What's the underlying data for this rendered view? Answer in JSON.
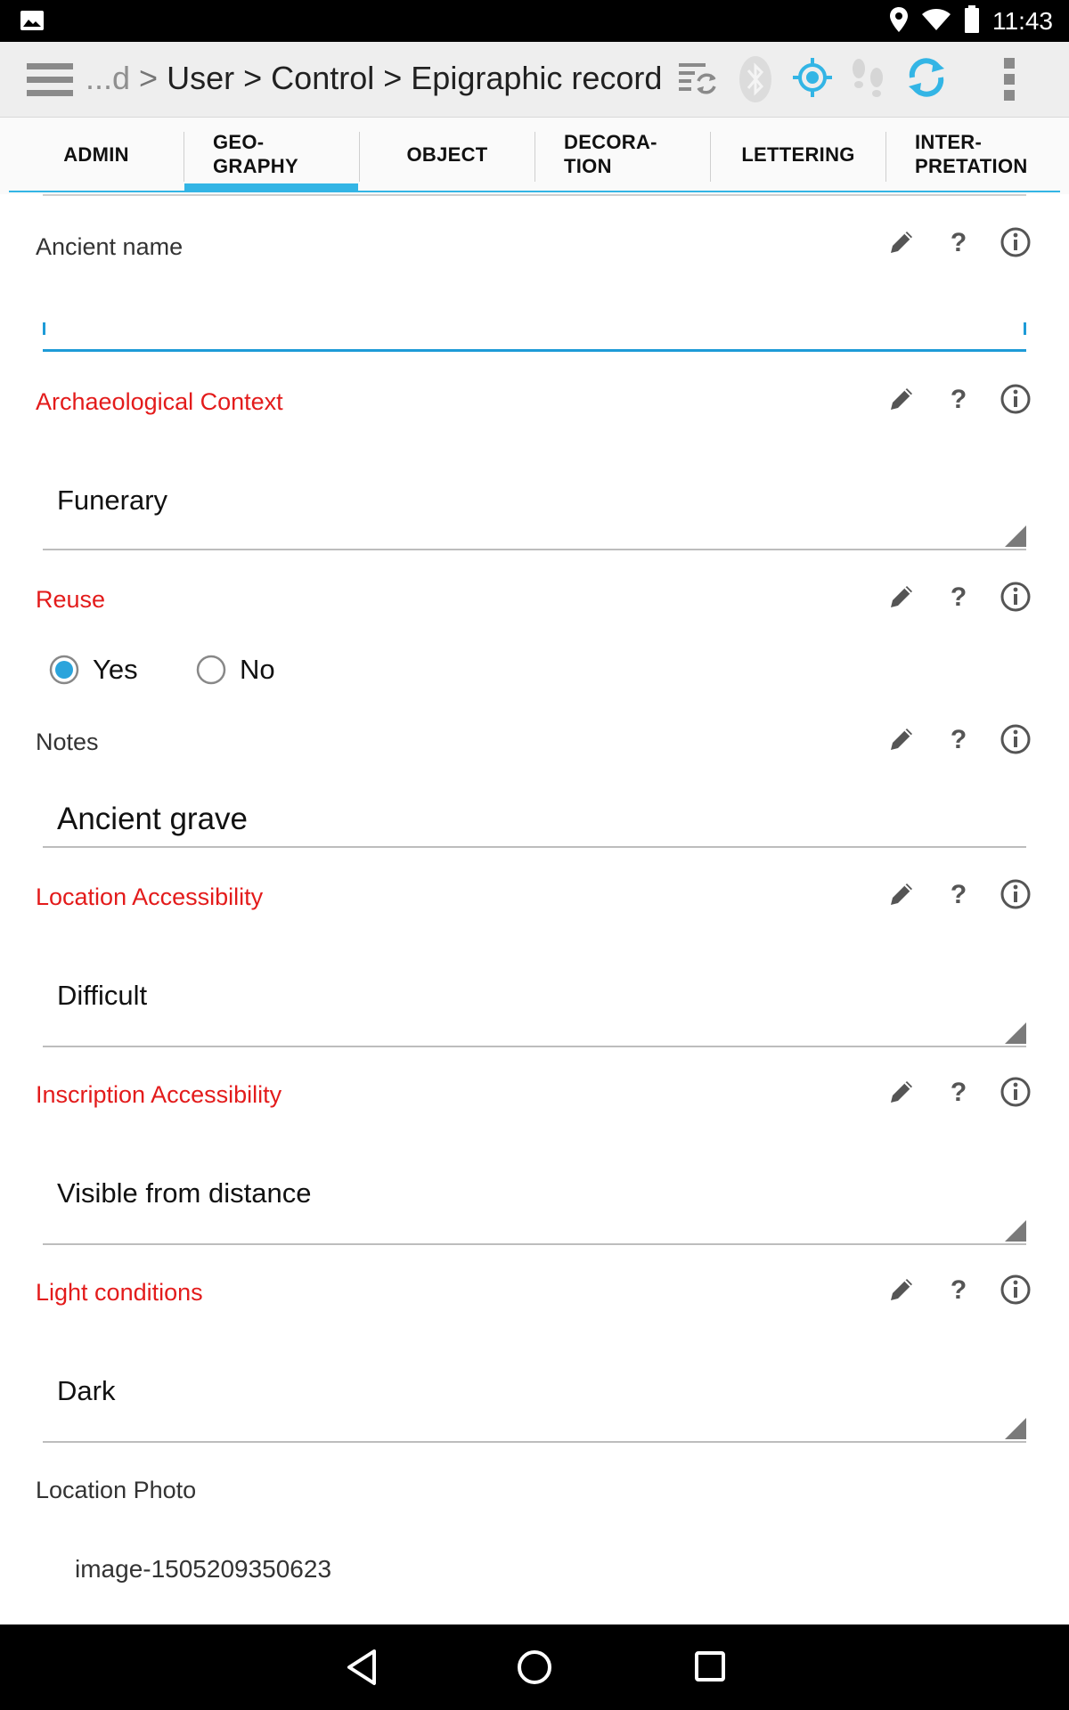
{
  "status_bar": {
    "time": "11:43",
    "icons": [
      "image-notification-icon",
      "location-icon",
      "wifi-icon",
      "battery-icon"
    ]
  },
  "action_bar": {
    "breadcrumb": {
      "prefix": "...d",
      "sep": ">",
      "items": [
        "User",
        "Control",
        "Epigraphic record"
      ]
    },
    "icons": [
      "hamburger-menu-icon",
      "sync-list-icon",
      "bluetooth-icon",
      "gps-target-icon",
      "footsteps-icon",
      "refresh-icon",
      "overflow-menu-icon"
    ]
  },
  "tabs": [
    {
      "label": "ADMIN",
      "active": false
    },
    {
      "label": "GEO-\nGRAPHY",
      "active": true
    },
    {
      "label": "OBJECT",
      "active": false
    },
    {
      "label": "DECORA-\nTION",
      "active": false
    },
    {
      "label": "LETTERING",
      "active": false
    },
    {
      "label": "INTER-\nPRETATION",
      "active": false
    }
  ],
  "form": {
    "ancient_name": {
      "label": "Ancient name",
      "value": ""
    },
    "archaeological_context": {
      "label": "Archaeological Context",
      "value": "Funerary"
    },
    "reuse": {
      "label": "Reuse",
      "options": [
        "Yes",
        "No"
      ],
      "selected": "Yes"
    },
    "notes": {
      "label": "Notes",
      "value": "Ancient grave"
    },
    "location_accessibility": {
      "label": "Location Accessibility",
      "value": "Difficult"
    },
    "inscription_accessibility": {
      "label": "Inscription Accessibility",
      "value": "Visible from distance"
    },
    "light_conditions": {
      "label": "Light conditions",
      "value": "Dark"
    },
    "location_photo": {
      "label": "Location Photo",
      "value": "image-1505209350623"
    }
  },
  "colors": {
    "accent": "#33b5e5",
    "required_label": "#e31b1b",
    "active_underline": "#1e9bd7"
  }
}
